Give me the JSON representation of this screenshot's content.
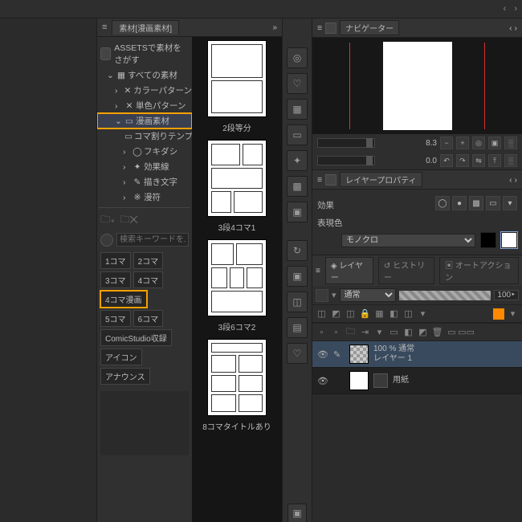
{
  "materialTab": "素材[漫画素材]",
  "assetsFind": "ASSETSで素材をさがす",
  "tree": {
    "all": "すべての素材",
    "colorPattern": "カラーパターン",
    "monoPattern": "単色パターン",
    "manga": "漫画素材",
    "komaTemplate": "コマ割りテンプ",
    "fukidashi": "フキダシ",
    "effectLine": "効果線",
    "drawnText": "描き文字",
    "manpu": "漫符"
  },
  "searchPlaceholder": "検索キーワードを入…",
  "tags": {
    "k1": "1コマ",
    "k2": "2コマ",
    "k3": "3コマ",
    "k4": "4コマ",
    "k4m": "4コマ漫画",
    "k5": "5コマ",
    "k6": "6コマ",
    "cs": "ComicStudio収録",
    "icon": "アイコン",
    "announce": "アナウンス"
  },
  "thumbs": {
    "t1": "2段等分",
    "t2": "3段4コマ1",
    "t3": "3段6コマ2",
    "t4": "8コマタイトルあり"
  },
  "nav": {
    "title": "ナビゲーター",
    "zoom": "8.3",
    "angle": "0.0"
  },
  "layerProp": {
    "title": "レイヤープロパティ",
    "effect": "効果",
    "expColor": "表現色",
    "mono": "モノクロ"
  },
  "layers": {
    "tabLayer": "レイヤー",
    "tabHistory": "ヒストリー",
    "tabAuto": "オートアクション",
    "blend": "通常",
    "opacity": "100",
    "l1a": "100 % 通常",
    "l1b": "レイヤー 1",
    "l2": "用紙"
  }
}
